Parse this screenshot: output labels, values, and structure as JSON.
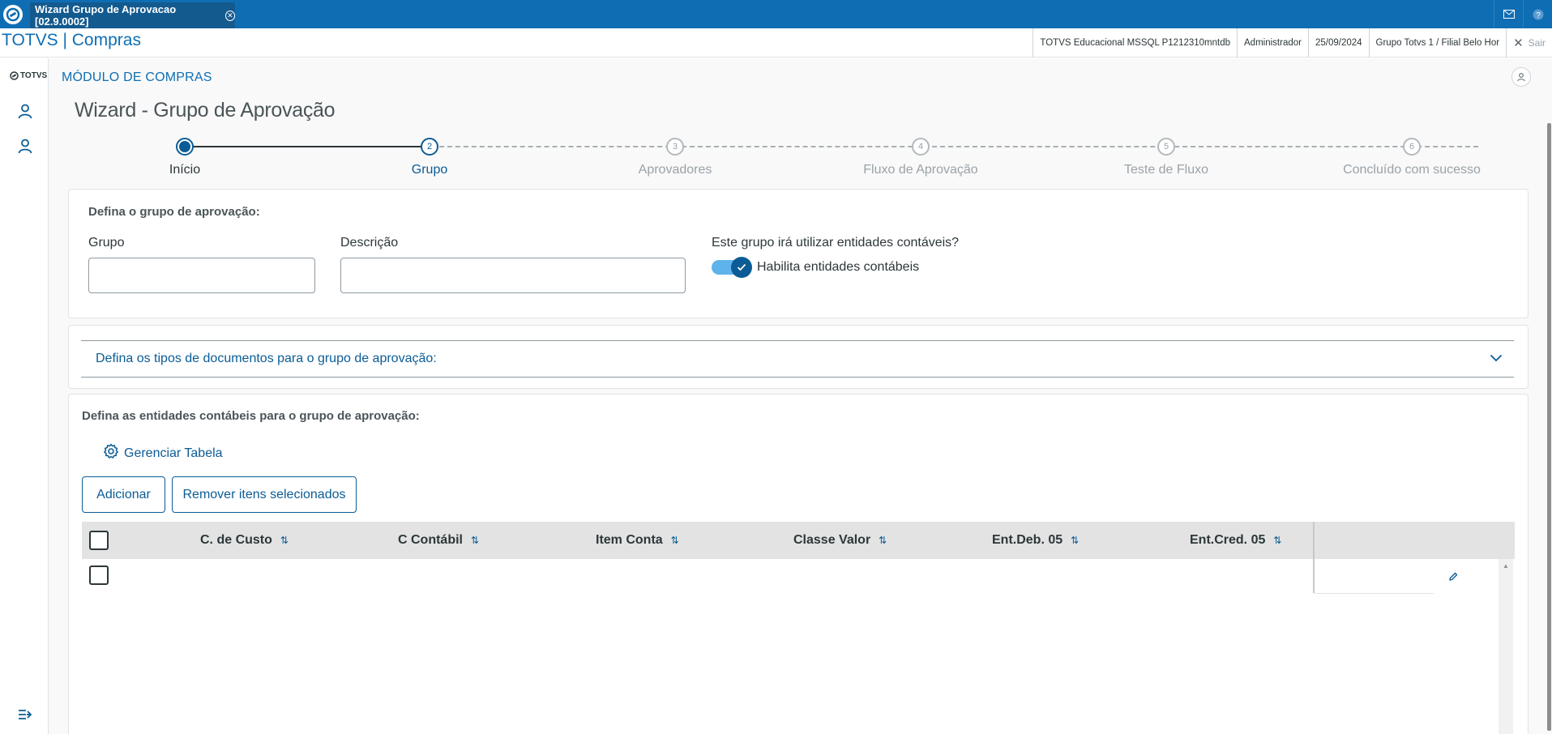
{
  "window": {
    "tab_title": "Wizard Grupo de Aprovacao [02.9.0002]",
    "tab_close": "✕",
    "mail_icon": "mail-icon",
    "help_icon": "help-icon"
  },
  "header": {
    "brand": "TOTVS | Compras",
    "environment": "TOTVS Educacional MSSQL P1212310mntdb",
    "user": "Administrador",
    "date": "25/09/2024",
    "branch": "Grupo Totvs 1 / Filial Belo Hor",
    "exit_label": "Sair"
  },
  "rail": {
    "logo_text": "TOTVS",
    "items": [
      "user-icon",
      "user-icon"
    ],
    "expand_icon": "expand-menu-icon"
  },
  "module": {
    "title": "MÓDULO DE COMPRAS"
  },
  "page": {
    "title": "Wizard - Grupo de Aprovação"
  },
  "stepper": {
    "steps": [
      {
        "number": "",
        "label": "Início",
        "state": "done"
      },
      {
        "number": "2",
        "label": "Grupo",
        "state": "active"
      },
      {
        "number": "3",
        "label": "Aprovadores",
        "state": "todo"
      },
      {
        "number": "4",
        "label": "Fluxo de Aprovação",
        "state": "todo"
      },
      {
        "number": "5",
        "label": "Teste de Fluxo",
        "state": "todo"
      },
      {
        "number": "6",
        "label": "Concluído com sucesso",
        "state": "todo"
      }
    ]
  },
  "group_form": {
    "title": "Defina o grupo de aprovação:",
    "group_label": "Grupo",
    "group_value": "",
    "description_label": "Descrição",
    "description_value": "",
    "entities_question": "Este grupo irá utilizar entidades contáveis?",
    "switch_label": "Habilita entidades contábeis",
    "switch_on": true
  },
  "documents_section": {
    "title": "Defina os tipos de documentos para o grupo de aprovação:"
  },
  "entities_section": {
    "title": "Defina as entidades contábeis para o grupo de aprovação:",
    "manage_label": "Gerenciar Tabela",
    "add_button": "Adicionar",
    "remove_button": "Remover itens selecionados",
    "table": {
      "columns": [
        "C. de Custo",
        "C Contábil",
        "Item Conta",
        "Classe Valor",
        "Ent.Deb. 05",
        "Ent.Cred. 05"
      ],
      "sort_icon": "⇅",
      "rows": [
        {
          "cells": [
            "",
            "",
            "",
            "",
            "",
            ""
          ],
          "checked": false
        }
      ]
    }
  },
  "colors": {
    "topbar": "#0f6eb3",
    "primary": "#0b5c96",
    "switch_track": "#5eb3ea",
    "table_header": "#e3e3e3",
    "page_bg": "#f9f9f9"
  }
}
